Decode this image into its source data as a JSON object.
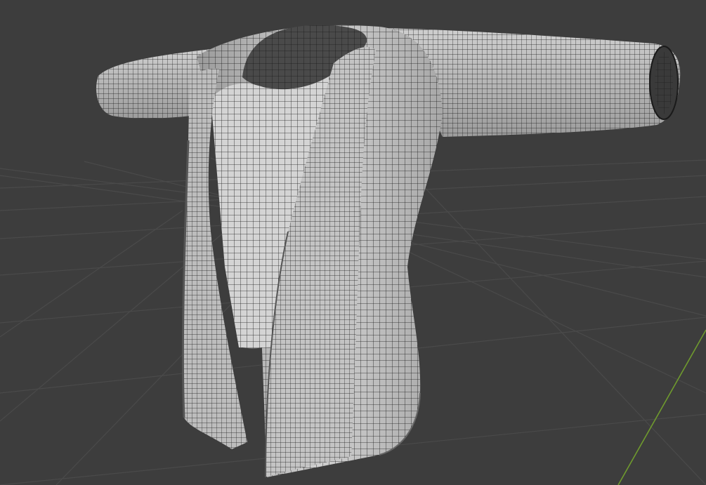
{
  "viewport": {
    "background": "#3d3d3d",
    "grid_color": "#4a4a4a",
    "y_axis_color": "#6f9a2e",
    "show_floor_grid": true,
    "show_wireframe": true
  },
  "object": {
    "name": "jacket-mesh",
    "base_color": "#c8c8c8",
    "shadow_color": "#8f8f8f",
    "wire_color": "#1a1a1a"
  }
}
